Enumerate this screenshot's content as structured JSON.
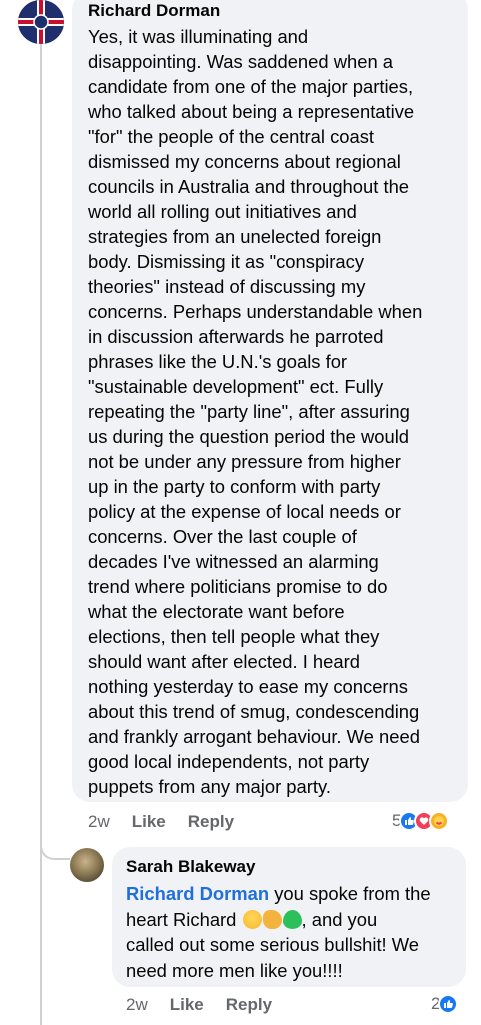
{
  "comment": {
    "author": "Richard Dorman",
    "lines": [
      "Yes, it was illuminating and",
      "disappointing. Was saddened when a",
      "candidate from one of the major parties,",
      "who talked about being a representative",
      "\"for\" the people of the central coast",
      "dismissed my concerns about regional",
      "councils in Australia and throughout the",
      "world all rolling out initiatives and",
      "strategies from an unelected foreign",
      "body. Dismissing it as \"conspiracy",
      "theories\" instead of discussing my",
      "concerns. Perhaps understandable when",
      "in discussion afterwards he parroted",
      "phrases like the U.N.'s goals for",
      "\"sustainable development\" ect. Fully",
      "repeating the \"party line\", after assuring",
      "us during the question period the would",
      "not be under any pressure from higher",
      "up in the party to conform with party",
      "policy at the expense of local needs or",
      "concerns. Over the last couple of",
      "decades I've witnessed an alarming",
      "trend where politicians promise to do",
      "what the electorate want before",
      "elections, then tell people what they",
      "should want after elected. I heard",
      "nothing yesterday to ease my concerns",
      "about this trend of smug, condescending",
      "and frankly arrogant behaviour. We need",
      "good local independents, not party",
      "puppets from any major party."
    ],
    "time": "2w",
    "like_label": "Like",
    "reply_label": "Reply",
    "reaction_count": "5",
    "reactions": [
      "like-icon",
      "love-icon",
      "care-icon"
    ]
  },
  "reply": {
    "author": "Sarah Blakeway",
    "mention": "Richard Dorman",
    "line1_rest": " you spoke from the",
    "line2": "heart Richard",
    "line2_tail": ", and you",
    "line3": "called out some serious bullshit! We",
    "line4": "need more men like you!!!!",
    "emojis": [
      "pleading-face-emoji",
      "flexed-biceps-emoji",
      "green-heart-emoji"
    ],
    "time": "2w",
    "like_label": "Like",
    "reply_label": "Reply",
    "reaction_count": "2",
    "reactions": [
      "like-icon"
    ]
  },
  "colors": {
    "bubble": "#f0f2f5",
    "mention": "#216fdb",
    "meta": "#65676b",
    "like": "#1877f2",
    "love": "#f33e58",
    "care": "#f7b125"
  }
}
